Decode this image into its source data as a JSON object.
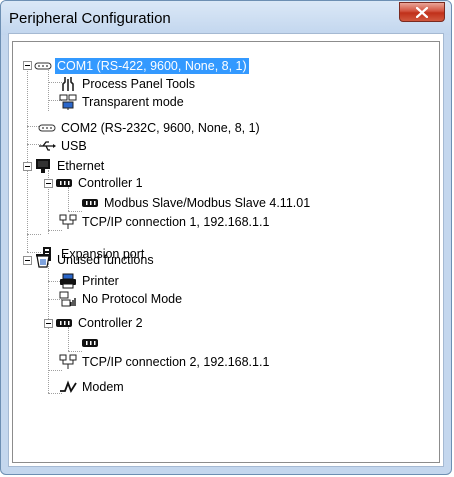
{
  "window": {
    "title": "Peripheral Configuration",
    "close_label": "x"
  },
  "tree": {
    "items": [
      {
        "label": "COM1  (RS-422, 9600, None, 8, 1)",
        "icon": "serial-port-icon",
        "selected": true
      },
      {
        "label": "Process Panel Tools",
        "icon": "tools-icon"
      },
      {
        "label": "Transparent mode",
        "icon": "network-computer-icon"
      },
      {
        "label": "COM2  (RS-232C, 9600, None, 8, 1)",
        "icon": "serial-port-icon"
      },
      {
        "label": "USB",
        "icon": "usb-icon"
      },
      {
        "label": "Ethernet",
        "icon": "ethernet-icon"
      },
      {
        "label": "Controller 1",
        "icon": "controller-icon"
      },
      {
        "label": "Modbus Slave/Modbus Slave 4.11.01",
        "icon": "device-icon"
      },
      {
        "label": "TCP/IP connection 1, 192.168.1.1",
        "icon": "network-icon"
      },
      {
        "label": "Expansion port",
        "icon": "expansion-icon"
      },
      {
        "label": "Unused functions",
        "icon": "unused-functions-icon"
      },
      {
        "label": "Printer",
        "icon": "printer-icon"
      },
      {
        "label": "No Protocol Mode",
        "icon": "no-protocol-icon"
      },
      {
        "label": "Controller 2",
        "icon": "controller-icon"
      },
      {
        "label": "",
        "icon": "device-icon"
      },
      {
        "label": "TCP/IP connection 2, 192.168.1.1",
        "icon": "network-icon"
      },
      {
        "label": "Modem",
        "icon": "modem-icon"
      }
    ]
  }
}
